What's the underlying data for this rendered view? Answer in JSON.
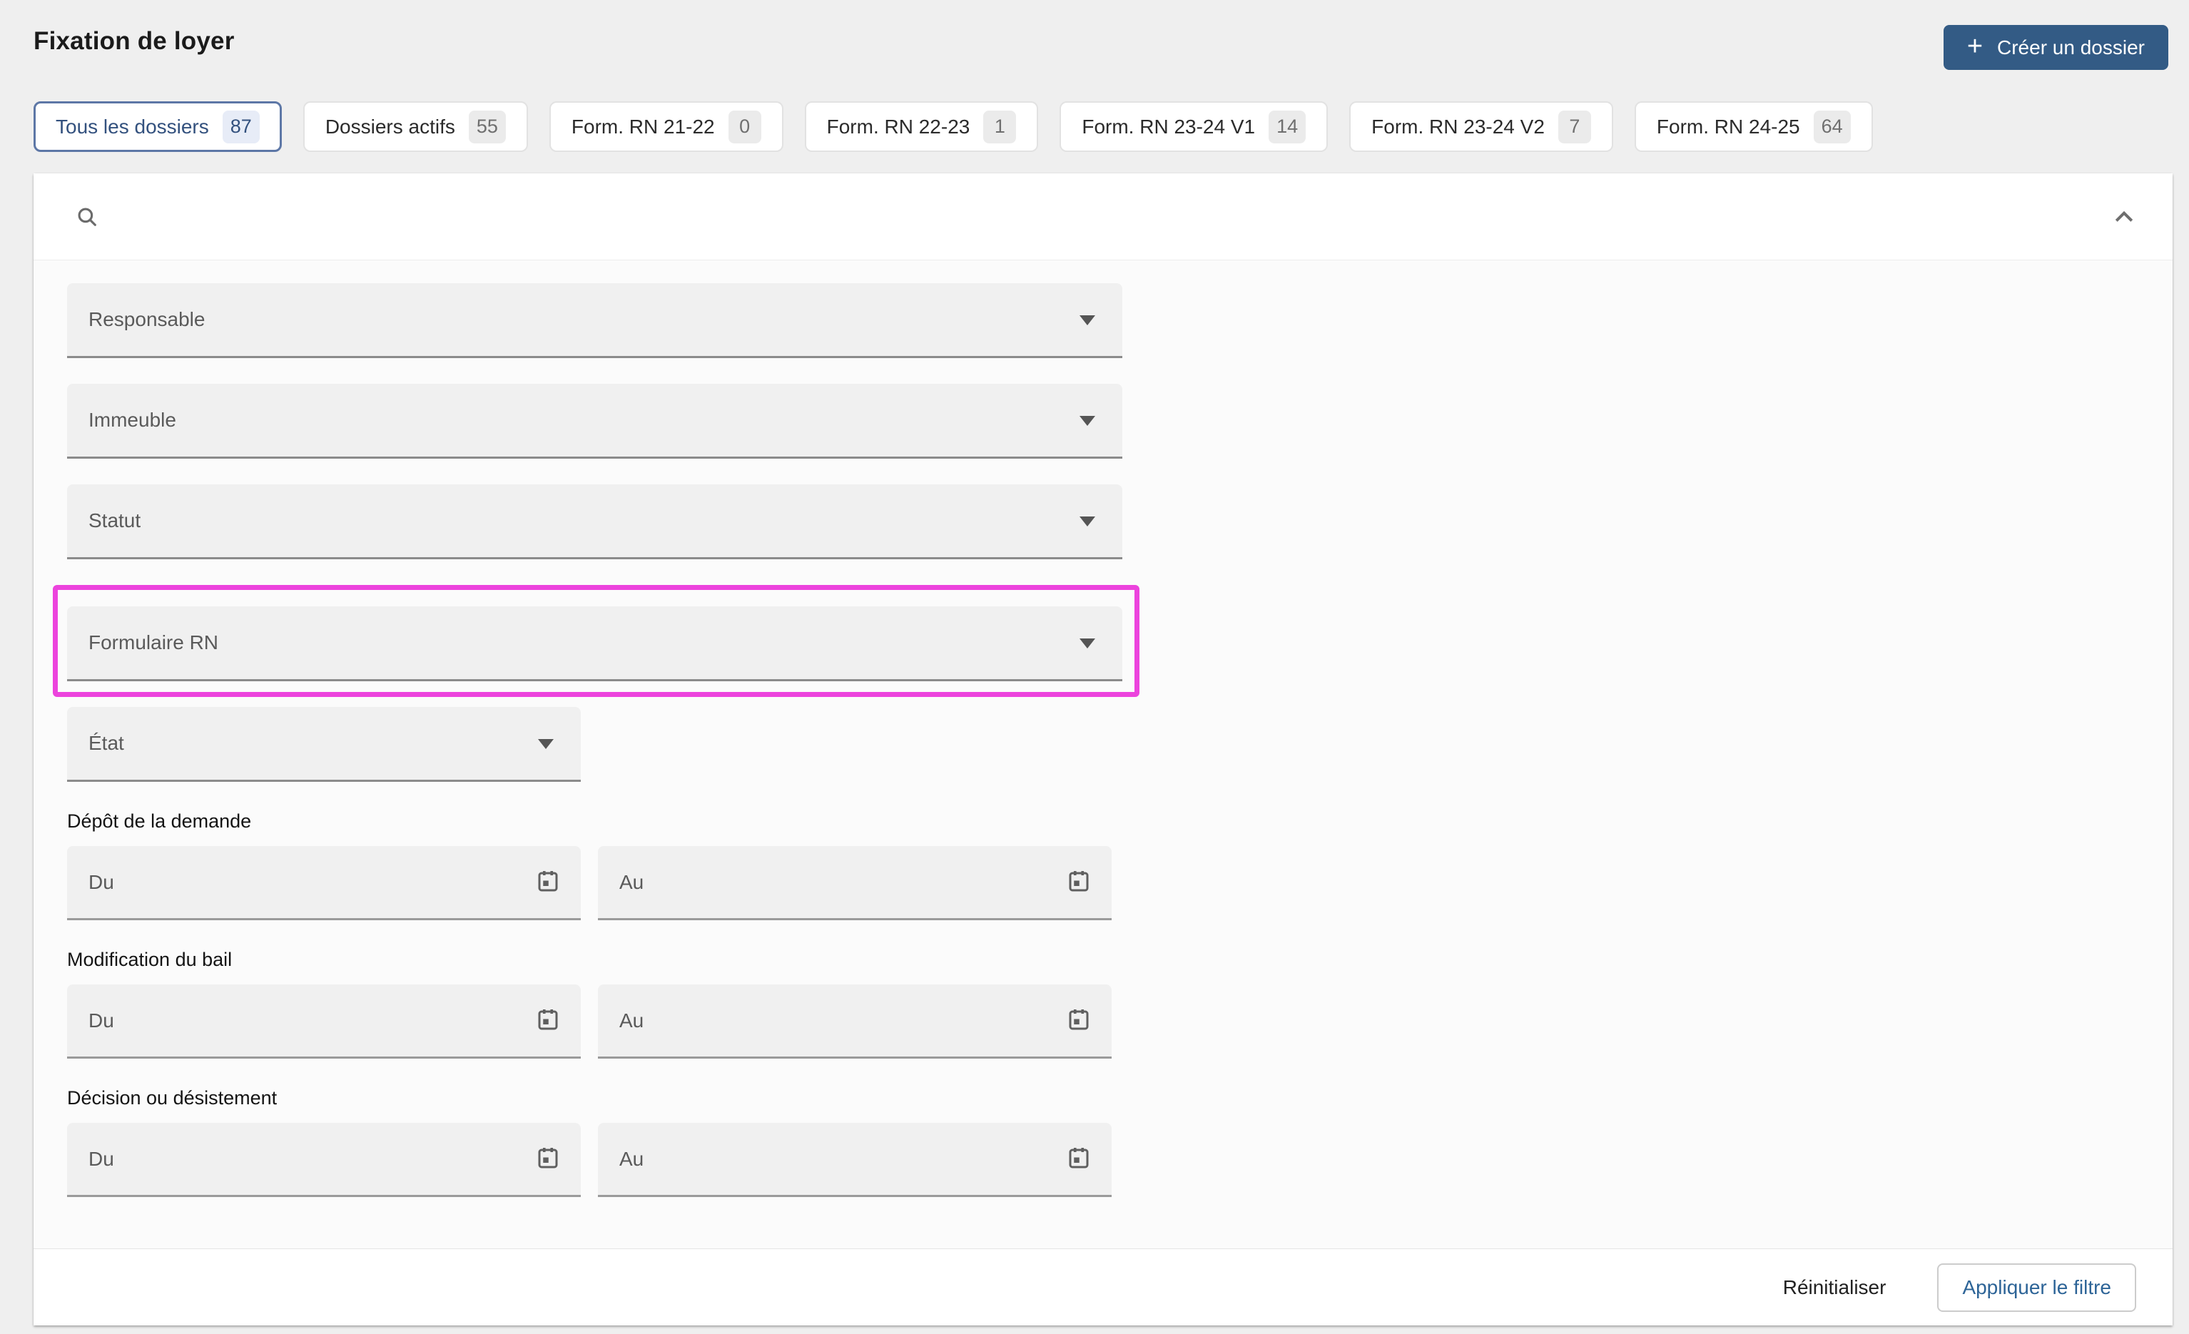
{
  "page": {
    "title": "Fixation de loyer"
  },
  "header": {
    "create_button": {
      "label": "Créer un dossier",
      "icon": "plus-icon"
    }
  },
  "tabs": [
    {
      "label": "Tous les dossiers",
      "count": "87",
      "selected": true
    },
    {
      "label": "Dossiers actifs",
      "count": "55",
      "selected": false
    },
    {
      "label": "Form. RN 21-22",
      "count": "0",
      "selected": false
    },
    {
      "label": "Form. RN 22-23",
      "count": "1",
      "selected": false
    },
    {
      "label": "Form. RN 23-24 V1",
      "count": "14",
      "selected": false
    },
    {
      "label": "Form. RN 23-24 V2",
      "count": "7",
      "selected": false
    },
    {
      "label": "Form. RN 24-25",
      "count": "64",
      "selected": false
    }
  ],
  "filter_panel": {
    "search": {
      "value": "",
      "placeholder": "",
      "icons": [
        "search-icon",
        "chevron-up-icon"
      ]
    },
    "selects": [
      {
        "label": "Responsable",
        "highlighted": false
      },
      {
        "label": "Immeuble",
        "highlighted": false
      },
      {
        "label": "Statut",
        "highlighted": false
      },
      {
        "label": "Formulaire RN",
        "highlighted": true
      },
      {
        "label": "État",
        "highlighted": false
      }
    ],
    "date_ranges": [
      {
        "label": "Dépôt de la demande",
        "from_placeholder": "Du",
        "to_placeholder": "Au"
      },
      {
        "label": "Modification du bail",
        "from_placeholder": "Du",
        "to_placeholder": "Au"
      },
      {
        "label": "Décision ou désistement",
        "from_placeholder": "Du",
        "to_placeholder": "Au"
      }
    ],
    "footer": {
      "reset_label": "Réinitialiser",
      "apply_label": "Appliquer le filtre"
    }
  },
  "colors": {
    "page_background": "#efefef",
    "primary_button": "#335b85",
    "selected_tab_border": "#5d77a6",
    "selected_tab_text": "#33517e",
    "selected_badge_background": "#e7ecf7",
    "highlight_border": "#ec43dd",
    "apply_button_text": "#2d6497",
    "field_background": "#f0f0f0"
  }
}
